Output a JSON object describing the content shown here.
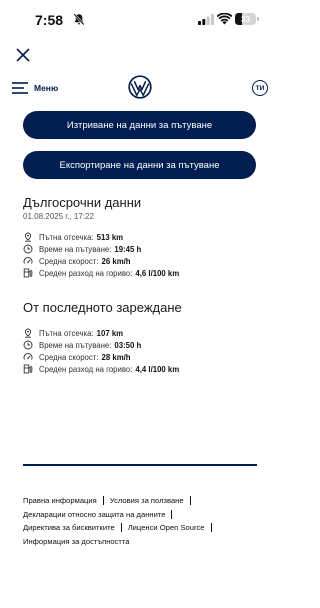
{
  "status_bar": {
    "time": "7:58",
    "battery": "33",
    "battery_percent": 33
  },
  "header": {
    "menu_label": "Меню",
    "account_initials": "ТИ"
  },
  "actions": {
    "delete_label": "Изтриване на данни за пътуване",
    "export_label": "Експортиране на данни за пътуване"
  },
  "long_term": {
    "title": "Дългосрочни данни",
    "date": "01.08.2025 г., 17:22",
    "stats": [
      {
        "icon": "location-pin-icon",
        "label": "Пътна отсечка:",
        "value": "513 km"
      },
      {
        "icon": "clock-icon",
        "label": "Време на пътуване:",
        "value": "19:45 h"
      },
      {
        "icon": "speedometer-icon",
        "label": "Средна скорост:",
        "value": "26 km/h"
      },
      {
        "icon": "fuel-pump-icon",
        "label": "Среден разход на гориво:",
        "value": "4,6 l/100 km"
      }
    ]
  },
  "since_refuel": {
    "title": "От последното зареждане",
    "stats": [
      {
        "icon": "location-pin-icon",
        "label": "Пътна отсечка:",
        "value": "107 km"
      },
      {
        "icon": "clock-icon",
        "label": "Време на пътуване:",
        "value": "03:50 h"
      },
      {
        "icon": "speedometer-icon",
        "label": "Средна скорост:",
        "value": "28 km/h"
      },
      {
        "icon": "fuel-pump-icon",
        "label": "Среден разход на гориво:",
        "value": "4,4 l/100 km"
      }
    ]
  },
  "footer": {
    "legal": "Правна информация",
    "terms": "Условия за ползване",
    "privacy": "Декларации относно защита на данните",
    "cookies": "Директива за бисквитките",
    "licenses": "Лиценси Open Source",
    "accessibility": "Информация за достъпността"
  },
  "colors": {
    "brand": "#001e50",
    "text": "#1a1a1a",
    "muted": "#555555"
  }
}
